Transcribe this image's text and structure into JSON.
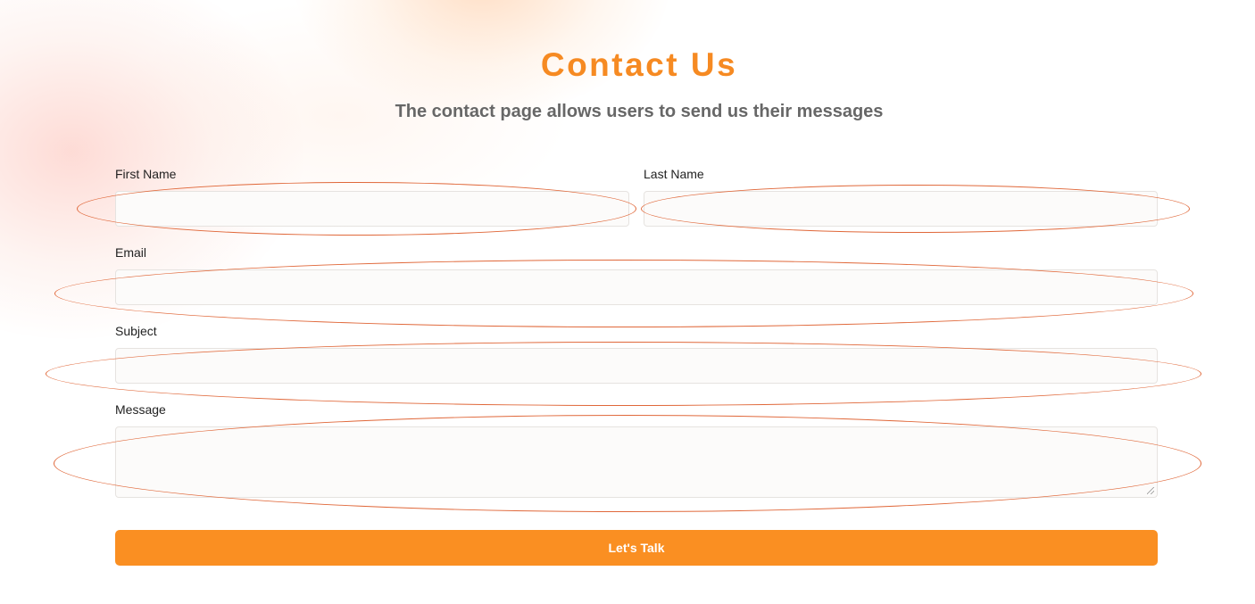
{
  "header": {
    "title": "Contact Us",
    "subtitle": "The contact page allows users to send us their messages"
  },
  "form": {
    "first_name": {
      "label": "First Name",
      "value": "",
      "placeholder": ""
    },
    "last_name": {
      "label": "Last Name",
      "value": "",
      "placeholder": ""
    },
    "email": {
      "label": "Email",
      "value": "",
      "placeholder": ""
    },
    "subject": {
      "label": "Subject",
      "value": "",
      "placeholder": ""
    },
    "message": {
      "label": "Message",
      "value": "",
      "placeholder": ""
    },
    "submit_label": "Let's Talk"
  },
  "colors": {
    "accent": "#fa8f22",
    "heading": "#f68a22",
    "subtitle": "#676767",
    "annotation": "#e0683a"
  }
}
